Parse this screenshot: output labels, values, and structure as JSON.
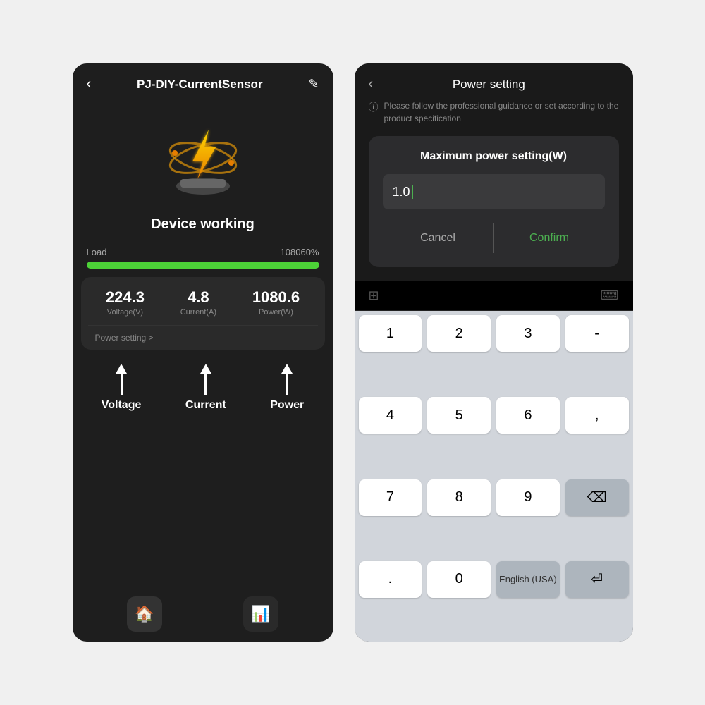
{
  "left": {
    "header": {
      "back": "‹",
      "title": "PJ-DIY-CurrentSensor",
      "edit": "✎"
    },
    "device_status": "Device working",
    "load": {
      "label": "Load",
      "value": "108060%"
    },
    "metrics": [
      {
        "value": "224.3",
        "label": "Voltage(V)"
      },
      {
        "value": "4.8",
        "label": "Current(A)"
      },
      {
        "value": "1080.6",
        "label": "Power(W)"
      }
    ],
    "power_setting_link": "Power setting >",
    "arrow_labels": [
      "Voltage",
      "Current",
      "Power"
    ],
    "nav": {
      "home_icon": "⌂",
      "chart_icon": "📊"
    }
  },
  "right": {
    "header": {
      "back": "‹",
      "title": "Power setting"
    },
    "info_text": "Please follow the professional guidance or set according to the product specification",
    "modal": {
      "title": "Maximum power setting(W)",
      "input_value": "1.0",
      "cancel_label": "Cancel",
      "confirm_label": "Confirm"
    },
    "keyboard": {
      "keys": [
        "1",
        "2",
        "3",
        "-",
        "4",
        "5",
        "6",
        ",",
        "7",
        "8",
        "9",
        "⌫",
        ".",
        "0",
        "English (USA)",
        "↵"
      ]
    }
  }
}
